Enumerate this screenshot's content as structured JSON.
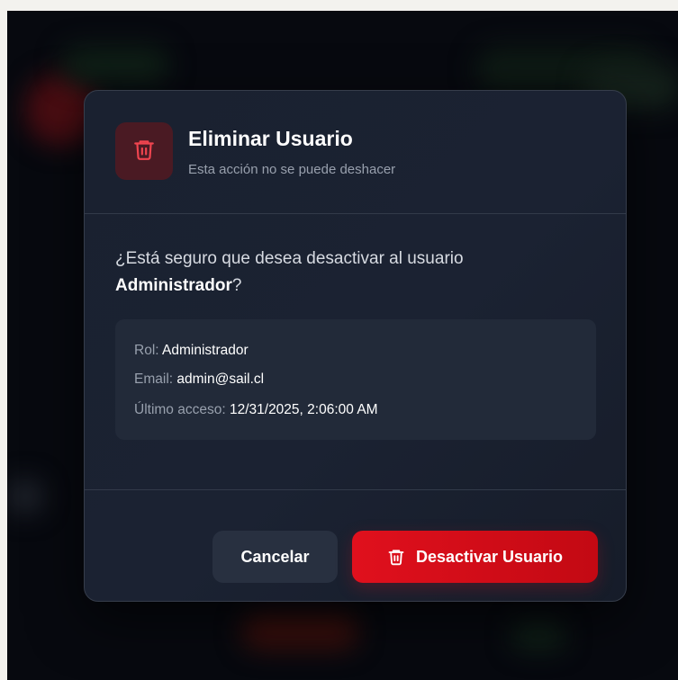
{
  "dialog": {
    "title": "Eliminar Usuario",
    "subtitle": "Esta acción no se puede deshacer",
    "question_prefix": "¿Está seguro que desea desactivar al usuario",
    "user_name": "Administrador",
    "question_suffix": "?",
    "details": {
      "role_label": "Rol:",
      "role_value": "Administrador",
      "email_label": "Email:",
      "email_value": "admin@sail.cl",
      "last_access_label": "Último acceso:",
      "last_access_value": "12/31/2025, 2:06:00 AM"
    },
    "cancel_label": "Cancelar",
    "confirm_label": "Desactivar Usuario"
  },
  "icons": {
    "header_icon": "trash-icon",
    "confirm_icon": "trash-icon"
  },
  "colors": {
    "danger": "#e0101d",
    "danger_icon": "#f0444f",
    "icon_box_bg": "#4a1a23",
    "modal_bg": "#1a2130",
    "overlay_bg": "#07090f"
  }
}
